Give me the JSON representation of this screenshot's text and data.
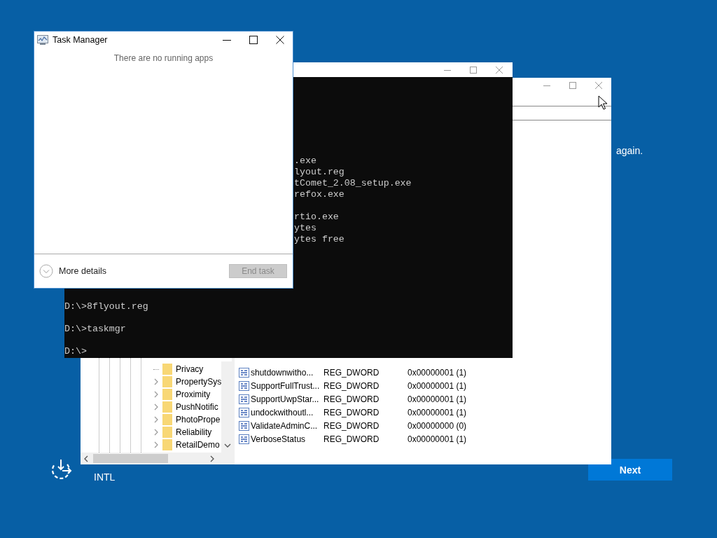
{
  "desktop": {
    "message_fragment": "again.",
    "keyboard_layout": "INTL",
    "next_button": "Next"
  },
  "registry_editor": {
    "tree_items": [
      {
        "label": "Privacy",
        "expandable": false
      },
      {
        "label": "PropertySys",
        "expandable": true
      },
      {
        "label": "Proximity",
        "expandable": true
      },
      {
        "label": "PushNotific",
        "expandable": true
      },
      {
        "label": "PhotoPrope",
        "expandable": true
      },
      {
        "label": "Reliability",
        "expandable": true
      },
      {
        "label": "RetailDemo",
        "expandable": true
      }
    ],
    "values": [
      {
        "name": "shutdownwitho...",
        "type": "REG_DWORD",
        "data": "0x00000001 (1)"
      },
      {
        "name": "SupportFullTrust...",
        "type": "REG_DWORD",
        "data": "0x00000001 (1)"
      },
      {
        "name": "SupportUwpStar...",
        "type": "REG_DWORD",
        "data": "0x00000001 (1)"
      },
      {
        "name": "undockwithoutl...",
        "type": "REG_DWORD",
        "data": "0x00000001 (1)"
      },
      {
        "name": "ValidateAdminC...",
        "type": "REG_DWORD",
        "data": "0x00000000 (0)"
      },
      {
        "name": "VerboseStatus",
        "type": "REG_DWORD",
        "data": "0x00000001 (1)"
      }
    ]
  },
  "command_prompt": {
    "output_blocks": [
      [
        ".exe",
        "lyout.reg",
        "tComet_2.08_setup.exe",
        "refox.exe"
      ],
      [
        "rtio.exe",
        "ytes",
        "ytes free"
      ]
    ],
    "prompts": [
      "D:\\>8flyout.reg",
      "D:\\>taskmgr",
      "D:\\>"
    ]
  },
  "task_manager": {
    "title": "Task Manager",
    "empty_message": "There are no running apps",
    "more_details": "More details",
    "end_task": {
      "label": "End task",
      "disabled": true
    }
  }
}
